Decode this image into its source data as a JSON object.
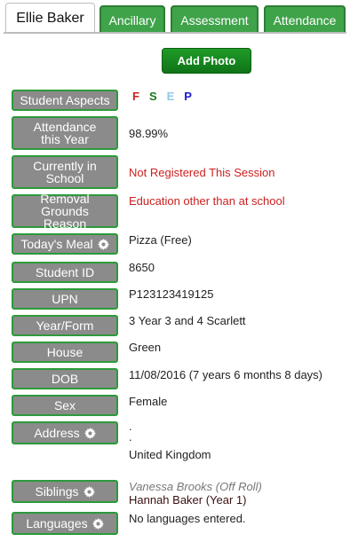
{
  "tabs": [
    {
      "label": "Ellie Baker"
    },
    {
      "label": "Ancillary"
    },
    {
      "label": "Assessment"
    },
    {
      "label": "Attendance"
    }
  ],
  "add_photo_label": "Add Photo",
  "fields": {
    "aspects": {
      "label": "Student Aspects",
      "letters": [
        "F",
        "S",
        "E",
        "P"
      ],
      "colors": [
        "#cc1f1f",
        "#1a7a1a",
        "#8fc9e8",
        "#1a1acc"
      ]
    },
    "attendance": {
      "label": "Attendance this Year",
      "value": "98.99%"
    },
    "in_school": {
      "label": "Currently in School",
      "value": "Not Registered This Session"
    },
    "removal": {
      "label": "Removal Grounds Reason",
      "value": "Education other than at school"
    },
    "meal": {
      "label": "Today's Meal",
      "value": "Pizza (Free)"
    },
    "student_id": {
      "label": "Student ID",
      "value": "8650"
    },
    "upn": {
      "label": "UPN",
      "value": "P123123419125"
    },
    "year_form": {
      "label": "Year/Form",
      "value": "3 Year 3 and 4 Scarlett"
    },
    "house": {
      "label": "House",
      "value": "Green"
    },
    "dob": {
      "label": "DOB",
      "value": "11/08/2016 (7 years 6 months 8 days)"
    },
    "sex": {
      "label": "Sex",
      "value": "Female"
    },
    "address": {
      "label": "Address",
      "line1": ".",
      "line2": ".",
      "country": "United Kingdom"
    },
    "siblings": {
      "label": "Siblings",
      "items": [
        "Vanessa Brooks (Off Roll)",
        "Hannah Baker (Year 1)"
      ]
    },
    "languages": {
      "label": "Languages",
      "value": "No languages entered."
    }
  },
  "colors": {
    "tab_green": "#3fa34a",
    "button_green": "#1f9b27",
    "label_grey": "#8b8b8b",
    "label_border": "#2c9a3a",
    "alert_red": "#cc1f1f"
  }
}
